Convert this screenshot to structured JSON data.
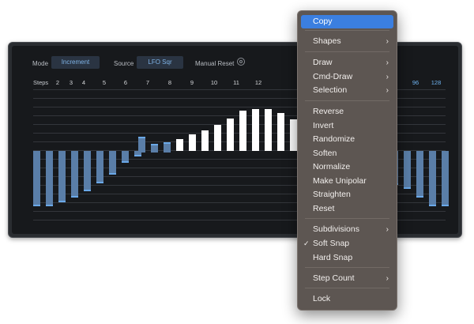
{
  "controls": {
    "mode_label": "Mode",
    "mode_value": "Increment",
    "source_label": "Source",
    "source_value": "LFO Sqr",
    "manual_reset_label": "Manual Reset"
  },
  "steps": {
    "label": "Steps",
    "numbers": [
      "2",
      "3",
      "4",
      "5",
      "6",
      "7",
      "8",
      "9",
      "10",
      "11",
      "12"
    ],
    "numbers_right": [
      "96",
      "128"
    ]
  },
  "bars": [
    -0.74,
    -0.74,
    -0.68,
    -0.62,
    -0.53,
    -0.42,
    -0.3,
    -0.14,
    -0.05,
    0.2,
    0.1,
    0.12,
    0.16,
    0.23,
    0.28,
    0.36,
    0.45,
    0.55,
    0.58,
    0.58,
    0.52,
    0.44,
    -0.45,
    -0.5,
    -0.62,
    -0.74,
    -0.74
  ],
  "menu": {
    "items": [
      {
        "label": "Copy",
        "active": true
      },
      {
        "label": "Shapes",
        "submenu": true
      },
      {
        "label": "Draw",
        "submenu": true
      },
      {
        "label": "Cmd-Draw",
        "submenu": true
      },
      {
        "label": "Selection",
        "submenu": true
      },
      {
        "label": "Reverse"
      },
      {
        "label": "Invert"
      },
      {
        "label": "Randomize"
      },
      {
        "label": "Soften"
      },
      {
        "label": "Normalize"
      },
      {
        "label": "Make Unipolar"
      },
      {
        "label": "Straighten"
      },
      {
        "label": "Reset"
      },
      {
        "label": "Subdivisions",
        "submenu": true
      },
      {
        "label": "Soft Snap",
        "checked": true
      },
      {
        "label": "Hard Snap"
      },
      {
        "label": "Step Count",
        "submenu": true
      },
      {
        "label": "Lock"
      }
    ],
    "check_glyph": "✓",
    "chevron_glyph": "›"
  }
}
